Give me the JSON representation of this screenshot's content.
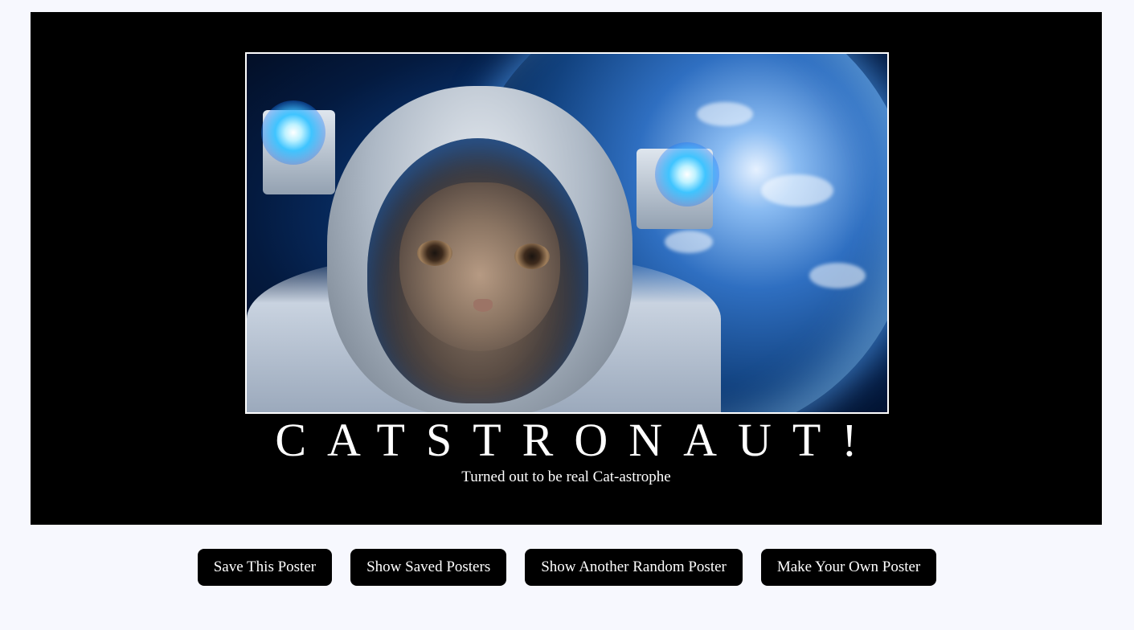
{
  "poster": {
    "image_alt": "Cat astronaut in space helmet with Earth in background",
    "title": "CATSTRONAUT!",
    "quote": "Turned out to be real Cat-astrophe"
  },
  "controls": {
    "save_label": "Save This Poster",
    "show_saved_label": "Show Saved Posters",
    "random_label": "Show Another Random Poster",
    "make_own_label": "Make Your Own Poster"
  },
  "colors": {
    "page_background": "#f7f8fe",
    "poster_background": "#000000",
    "button_background": "#000000",
    "text_light": "#ffffff"
  }
}
